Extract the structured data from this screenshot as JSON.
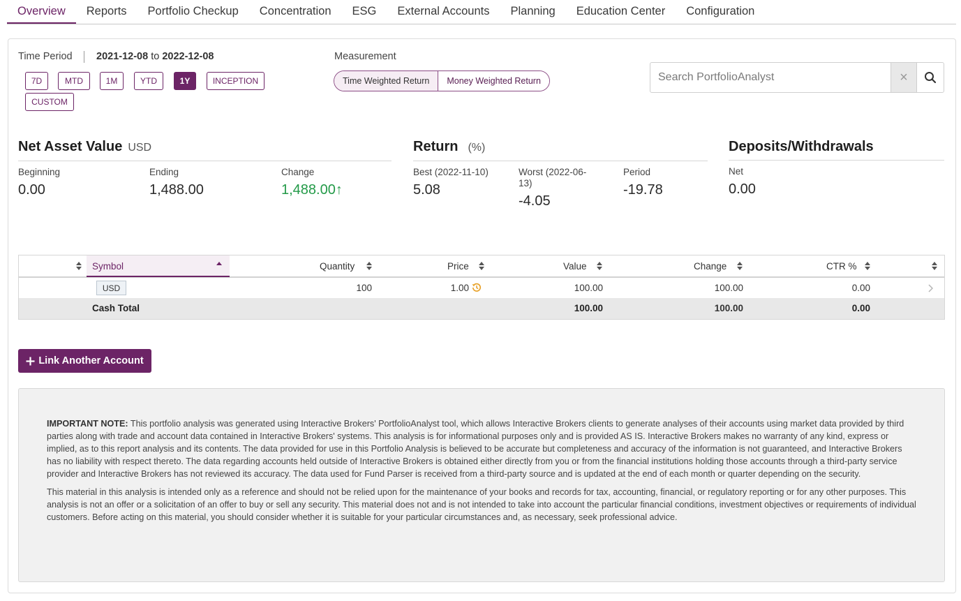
{
  "tabs": [
    "Overview",
    "Reports",
    "Portfolio Checkup",
    "Concentration",
    "ESG",
    "External Accounts",
    "Planning",
    "Education Center",
    "Configuration"
  ],
  "time_period": {
    "label": "Time Period",
    "start": "2021-12-08",
    "to": "to",
    "end": "2022-12-08",
    "buttons": [
      "7D",
      "MTD",
      "1M",
      "YTD",
      "1Y",
      "INCEPTION",
      "CUSTOM"
    ],
    "active": "1Y"
  },
  "measurement": {
    "label": "Measurement",
    "options": [
      "Time Weighted Return",
      "Money Weighted Return"
    ],
    "active": "Time Weighted Return"
  },
  "search": {
    "placeholder": "Search PortfolioAnalyst",
    "clear": "×"
  },
  "nav": {
    "title": "Net Asset Value",
    "unit": "USD",
    "beginning_label": "Beginning",
    "beginning": "0.00",
    "ending_label": "Ending",
    "ending": "1,488.00",
    "change_label": "Change",
    "change": "1,488.00",
    "change_arrow": "↑"
  },
  "return": {
    "title": "Return",
    "unit": "(%)",
    "best_label": "Best (2022-11-10)",
    "best": "5.08",
    "worst_label_line1": "Worst (2022-06-",
    "worst_label_line2": "13)",
    "worst": "-4.05",
    "period_label": "Period",
    "period": "-19.78"
  },
  "deposits": {
    "title": "Deposits/Withdrawals",
    "net_label": "Net",
    "net": "0.00"
  },
  "table": {
    "headers": {
      "symbol": "Symbol",
      "quantity": "Quantity",
      "price": "Price",
      "value": "Value",
      "change": "Change",
      "ctr": "CTR %"
    },
    "rows": [
      {
        "symbol": "USD",
        "quantity": "100",
        "price": "1.00",
        "value": "100.00",
        "change": "100.00",
        "ctr": "0.00"
      }
    ],
    "total": {
      "label": "Cash Total",
      "value": "100.00",
      "change": "100.00",
      "ctr": "0.00"
    }
  },
  "link_button": "Link Another Account",
  "note": {
    "heading": "IMPORTANT NOTE:",
    "p1": "This portfolio analysis was generated using Interactive Brokers' PortfolioAnalyst tool, which allows Interactive Brokers clients to generate analyses of their accounts using market data provided by third parties along with trade and account data contained in Interactive Brokers' systems. This analysis is for informational purposes only and is provided AS IS. Interactive Brokers makes no warranty of any kind, express or implied, as to this report analysis and its contents. The data provided for use in this Portfolio Analysis is believed to be accurate but completeness and accuracy of the information is not guaranteed, and Interactive Brokers has no liability with respect thereto. The data regarding accounts held outside of Interactive Brokers is obtained either directly from you or from the financial institutions holding those accounts through a third-party service provider and Interactive Brokers has not reviewed its accuracy. The data used for Fund Parser is received from a third-party source and is updated at the end of each month or quarter depending on the security.",
    "p2": "This material in this analysis is intended only as a reference and should not be relied upon for the maintenance of your books and records for tax, accounting, financial, or regulatory reporting or for any other purposes. This analysis is not an offer or a solicitation of an offer to buy or sell any security. This material does not and is not intended to take into account the particular financial conditions, investment objectives or requirements of individual customers. Before acting on this material, you should consider whether it is suitable for your particular circumstances and, as necessary, seek professional advice."
  },
  "colors": {
    "brand": "#6c2466",
    "positive": "#239a48",
    "history_icon": "#e8a22a"
  }
}
